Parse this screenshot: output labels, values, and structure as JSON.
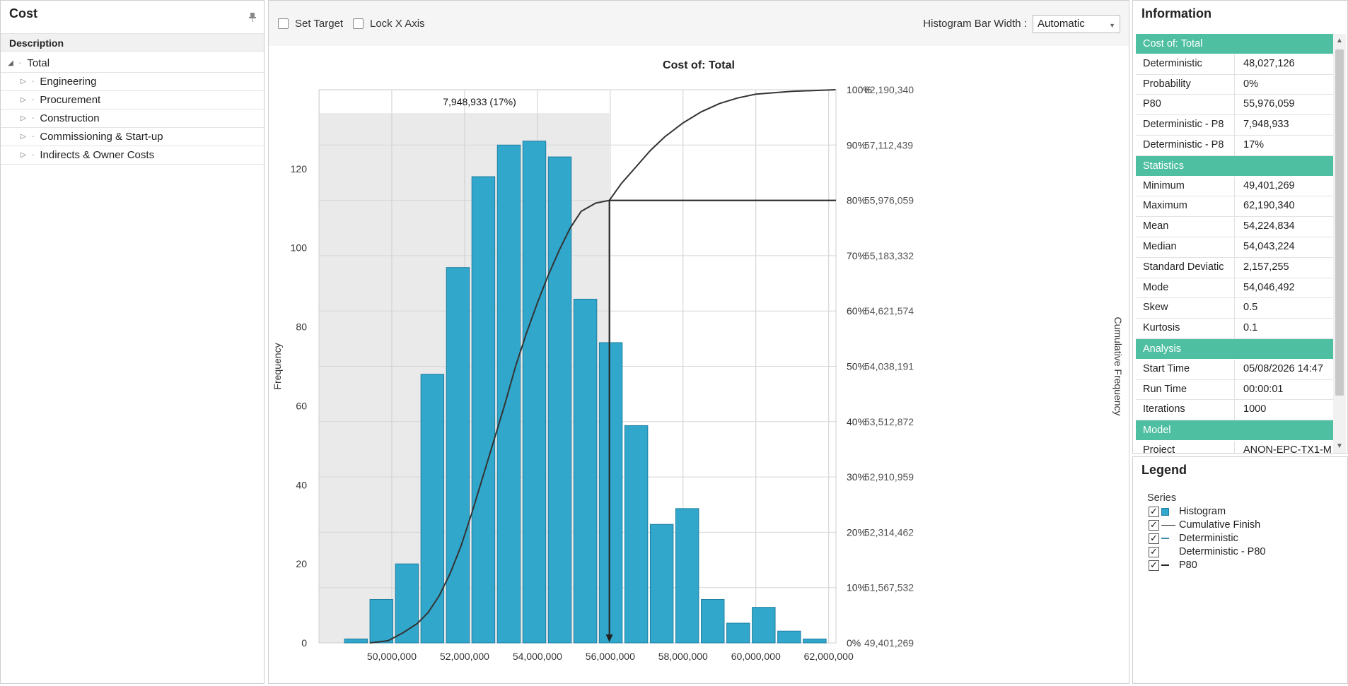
{
  "cost_panel": {
    "title": "Cost",
    "column_header": "Description",
    "tree": [
      {
        "label": "Total",
        "expanded": true
      },
      {
        "label": "Engineering"
      },
      {
        "label": "Procurement"
      },
      {
        "label": "Construction"
      },
      {
        "label": "Commissioning & Start-up"
      },
      {
        "label": "Indirects & Owner Costs"
      }
    ]
  },
  "toolbar": {
    "set_target": "Set Target",
    "lock_x_axis": "Lock X Axis",
    "bar_width_label": "Histogram Bar Width :",
    "bar_width_value": "Automatic"
  },
  "chart_data": {
    "type": "bar",
    "title": "Cost of: Total",
    "ylabel": "Frequency",
    "y2label": "Cumulative Frequency",
    "annotation": "7,948,933 (17%)",
    "x_ticks": [
      "50,000,000",
      "52,000,000",
      "54,000,000",
      "56,000,000",
      "58,000,000",
      "60,000,000",
      "62,000,000"
    ],
    "y_ticks": [
      "0",
      "20",
      "40",
      "60",
      "80",
      "100",
      "120"
    ],
    "y2_ticks": [
      {
        "pct": "0%",
        "val": "49,401,269"
      },
      {
        "pct": "10%",
        "val": "51,567,532"
      },
      {
        "pct": "20%",
        "val": "52,314,462"
      },
      {
        "pct": "30%",
        "val": "52,910,959"
      },
      {
        "pct": "40%",
        "val": "53,512,872"
      },
      {
        "pct": "50%",
        "val": "54,038,191"
      },
      {
        "pct": "60%",
        "val": "54,621,574"
      },
      {
        "pct": "70%",
        "val": "55,183,332"
      },
      {
        "pct": "80%",
        "val": "55,976,059"
      },
      {
        "pct": "90%",
        "val": "57,112,439"
      },
      {
        "pct": "100%",
        "val": "62,190,340"
      }
    ],
    "xlim": [
      48000000,
      62200000
    ],
    "ylim": [
      0,
      140
    ],
    "bins": [
      {
        "x": 48700000,
        "freq": 1
      },
      {
        "x": 49400000,
        "freq": 11
      },
      {
        "x": 50100000,
        "freq": 20
      },
      {
        "x": 50800000,
        "freq": 68
      },
      {
        "x": 51500000,
        "freq": 95
      },
      {
        "x": 52200000,
        "freq": 118
      },
      {
        "x": 52900000,
        "freq": 126
      },
      {
        "x": 53600000,
        "freq": 127
      },
      {
        "x": 54300000,
        "freq": 123
      },
      {
        "x": 55000000,
        "freq": 87
      },
      {
        "x": 55700000,
        "freq": 76
      },
      {
        "x": 56400000,
        "freq": 55
      },
      {
        "x": 57100000,
        "freq": 30
      },
      {
        "x": 57800000,
        "freq": 34
      },
      {
        "x": 58500000,
        "freq": 11
      },
      {
        "x": 59200000,
        "freq": 5
      },
      {
        "x": 59900000,
        "freq": 9
      },
      {
        "x": 60600000,
        "freq": 3
      },
      {
        "x": 61300000,
        "freq": 1
      }
    ],
    "bin_width": 630000,
    "cumulative": [
      [
        49401269,
        0
      ],
      [
        49900000,
        0.4
      ],
      [
        50300000,
        1.8
      ],
      [
        50700000,
        3.5
      ],
      [
        51000000,
        5.5
      ],
      [
        51300000,
        8.5
      ],
      [
        51600000,
        12.5
      ],
      [
        51900000,
        17.5
      ],
      [
        52200000,
        23.5
      ],
      [
        52500000,
        30
      ],
      [
        52800000,
        36.5
      ],
      [
        53100000,
        43
      ],
      [
        53400000,
        50
      ],
      [
        53700000,
        56
      ],
      [
        54000000,
        61.5
      ],
      [
        54300000,
        66.5
      ],
      [
        54600000,
        71
      ],
      [
        54900000,
        75
      ],
      [
        55200000,
        78
      ],
      [
        55600000,
        79.5
      ],
      [
        55976059,
        80
      ],
      [
        56300000,
        83
      ],
      [
        56700000,
        86
      ],
      [
        57100000,
        89
      ],
      [
        57500000,
        91.5
      ],
      [
        58000000,
        94
      ],
      [
        58500000,
        96
      ],
      [
        59000000,
        97.5
      ],
      [
        59500000,
        98.5
      ],
      [
        60000000,
        99.2
      ],
      [
        61000000,
        99.7
      ],
      [
        62190340,
        100
      ]
    ],
    "p80_value": 55976059,
    "p80_pct": 80,
    "shade_from": 48000000
  },
  "information": {
    "title": "Information",
    "sections": [
      {
        "header": "Cost of: Total",
        "rows": [
          {
            "k": "Deterministic",
            "v": "48,027,126"
          },
          {
            "k": "Probability",
            "v": "0%"
          },
          {
            "k": "P80",
            "v": "55,976,059"
          },
          {
            "k": "Deterministic - P8",
            "v": "7,948,933"
          },
          {
            "k": "Deterministic - P8",
            "v": "17%"
          }
        ]
      },
      {
        "header": "Statistics",
        "rows": [
          {
            "k": "Minimum",
            "v": "49,401,269"
          },
          {
            "k": "Maximum",
            "v": "62,190,340"
          },
          {
            "k": "Mean",
            "v": "54,224,834"
          },
          {
            "k": "Median",
            "v": "54,043,224"
          },
          {
            "k": "Standard Deviatic",
            "v": "2,157,255"
          },
          {
            "k": "Mode",
            "v": "54,046,492"
          },
          {
            "k": "Skew",
            "v": "0.5"
          },
          {
            "k": "Kurtosis",
            "v": "0.1"
          }
        ]
      },
      {
        "header": "Analysis",
        "rows": [
          {
            "k": "Start Time",
            "v": "05/08/2026 14:47"
          },
          {
            "k": "Run Time",
            "v": "00:00:01"
          },
          {
            "k": "Iterations",
            "v": "1000"
          }
        ]
      },
      {
        "header": "Model",
        "rows": [
          {
            "k": "Project",
            "v": "ANON-EPC-TX1-M"
          }
        ]
      }
    ]
  },
  "legend": {
    "title": "Legend",
    "series_title": "Series",
    "items": [
      {
        "label": "Histogram",
        "swatch": "box"
      },
      {
        "label": "Cumulative Finish",
        "swatch": "line"
      },
      {
        "label": "Deterministic",
        "swatch": "short-teal"
      },
      {
        "label": "Deterministic - P80",
        "swatch": "none"
      },
      {
        "label": "P80",
        "swatch": "short-dark"
      }
    ]
  },
  "colors": {
    "bar": "#31a7cb",
    "bar_stroke": "#1f7fa0",
    "shade": "#ebeaea",
    "cumulative": "#333333",
    "teal_header": "#4ebfa0"
  }
}
